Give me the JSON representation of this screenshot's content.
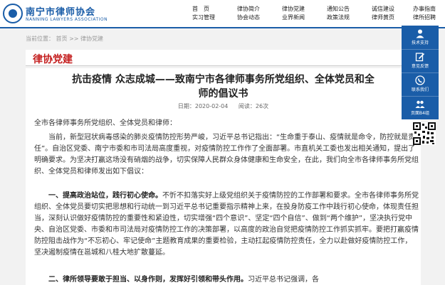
{
  "site": {
    "name": "南宁市律师协会",
    "subtitle": "NANNING LAWYERS ASSOCIATION"
  },
  "nav": {
    "columns": [
      [
        "首　页",
        "实习管理"
      ],
      [
        "律协简介",
        "协会动态"
      ],
      [
        "律协党建",
        "业界新闻"
      ],
      [
        "通知公告",
        "政策法规"
      ],
      [
        "诚信建设",
        "律师黄页"
      ],
      [
        "办事指南",
        "律所招聘"
      ]
    ]
  },
  "breadcrumb": {
    "label": "当前位置：",
    "home": "首页",
    "separator": ">>",
    "current": "律协党建"
  },
  "section": {
    "title": "律协党建"
  },
  "article": {
    "title_line1": "抗击疫情 众志成城——致南宁市各律师事务所党组织、全体党员和全",
    "title_line2": "师的倡议书",
    "date_label": "日期：2020-02-04",
    "views_label": "阅读：26次",
    "greeting": "全市各律师事务所党组织、全体党员和律师：",
    "p1": "当前，新型冠状病毒感染的肺炎疫情防控形势严峻，习近平总书记指出：“生命重于泰山、疫情就是命令，防控就是责任”。自治区党委、南宁市委和市司法局高度重视，对疫情防控工作作了全面部署。市直机关工委也发出相关通知，提出了明确要求。为坚决打赢这场没有硝烟的战争，切实保障人民群众身体健康和生命安全，在此，我们向全市各律师事务所党组织、全体党员和律师发出如下倡议：",
    "p2_head": "一、提高政治站位，践行初心使命。",
    "p2_body": "不忻不扣落实好上级党组织关于疫情防控的工作部署和要求。全市各律师事务所党组织、全体党员要切实把思想和行动统一到习近平总书记重要指示精神上来，在投身防疫工作中践行初心使命，体现责任担当，深刻认识做好疫情防控的重要性和紧迫性，切实增强“四个意识”、坚定“四个自信”、做到“两个维护”，坚决执行党中央、自治区党委、市委和市司法局对疫情防控工作的决策部署，以高度的政治自觉把疫情防控工作抓实抓牢。要把打赢疫情防控阻击战作为“不忘初心、牢记使命”主题教育成果的重要检验，主动扛起疫情防控责任，全力以赴做好疫情防控工作，坚决遏制疫情在邕城和八桂大地扩散蔓延。",
    "p3_head": "二、律所领导要敢于担当、以身作则，发挥好引领和带头作用。",
    "p3_body": "习近平总书记强调，各"
  },
  "sidebar": {
    "items": [
      {
        "label": "技术支持",
        "icon": "person-icon"
      },
      {
        "label": "意见反馈",
        "icon": "edit-icon"
      },
      {
        "label": "联系我们",
        "icon": "phone-icon"
      },
      {
        "label": "页面B4组",
        "icon": "group-icon"
      }
    ]
  },
  "colors": {
    "brand_blue": "#1a5da8",
    "section_red": "#c41f1f"
  }
}
